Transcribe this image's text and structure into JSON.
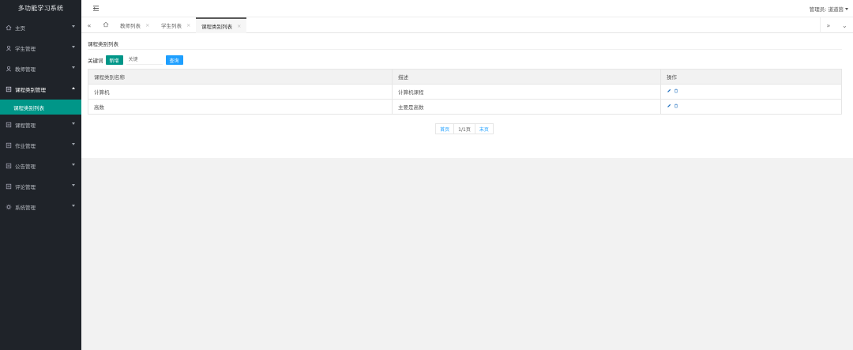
{
  "app": {
    "brand": "多功能学习系统"
  },
  "topbar": {
    "admin_label": "管理员: 道道茵"
  },
  "sidebar": {
    "items": [
      {
        "label": "主页",
        "icon": "home-icon"
      },
      {
        "label": "学生管理",
        "icon": "user-icon"
      },
      {
        "label": "教师管理",
        "icon": "user-icon"
      },
      {
        "label": "课程类别管理",
        "icon": "list-icon",
        "open": true
      },
      {
        "label": "课程管理",
        "icon": "list-icon"
      },
      {
        "label": "作业管理",
        "icon": "list-icon"
      },
      {
        "label": "公告管理",
        "icon": "list-icon"
      },
      {
        "label": "评论管理",
        "icon": "list-icon"
      },
      {
        "label": "系统管理",
        "icon": "gear-icon"
      }
    ],
    "sub_item": "课程类别列表"
  },
  "tabs": [
    {
      "label": "教师列表"
    },
    {
      "label": "学生列表"
    },
    {
      "label": "课程类别列表",
      "active": true
    }
  ],
  "page": {
    "title": "课程类别列表",
    "keyword_label": "关键词",
    "add_label": "新增",
    "keyword_placeholder": "关键",
    "search_label": "查询"
  },
  "table": {
    "headers": [
      "课程类别名称",
      "描述",
      "操作"
    ],
    "rows": [
      {
        "name": "计算机",
        "desc": "计算机课程"
      },
      {
        "name": "高数",
        "desc": "主要是高数"
      }
    ]
  },
  "pager": {
    "first": "首页",
    "current": "1/1页",
    "last": "末页"
  },
  "colors": {
    "sidebar_bg": "#1f2329",
    "accent": "#009688",
    "blue": "#1e9fff"
  }
}
